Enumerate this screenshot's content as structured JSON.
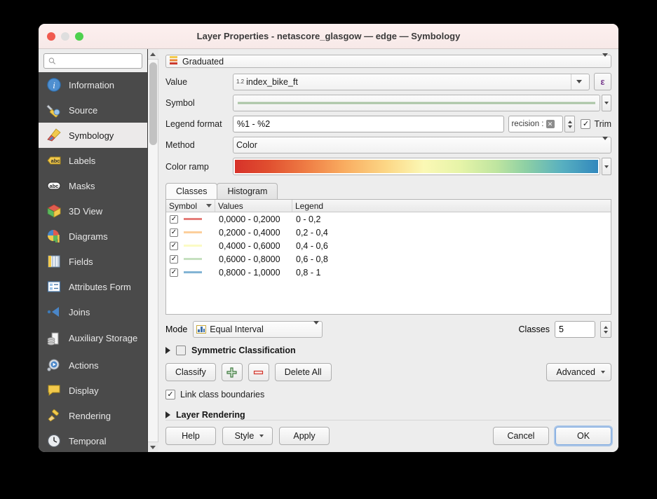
{
  "window": {
    "title": "Layer Properties - netascore_glasgow — edge — Symbology"
  },
  "sidebar": {
    "search_placeholder": "",
    "search_value": "",
    "items": [
      {
        "label": "Information",
        "icon": "information-icon"
      },
      {
        "label": "Source",
        "icon": "source-icon"
      },
      {
        "label": "Symbology",
        "icon": "symbology-icon",
        "active": true
      },
      {
        "label": "Labels",
        "icon": "labels-icon"
      },
      {
        "label": "Masks",
        "icon": "masks-icon"
      },
      {
        "label": "3D View",
        "icon": "3d-view-icon"
      },
      {
        "label": "Diagrams",
        "icon": "diagrams-icon"
      },
      {
        "label": "Fields",
        "icon": "fields-icon"
      },
      {
        "label": "Attributes Form",
        "icon": "attributes-form-icon"
      },
      {
        "label": "Joins",
        "icon": "joins-icon"
      },
      {
        "label": "Auxiliary Storage",
        "icon": "auxiliary-storage-icon"
      },
      {
        "label": "Actions",
        "icon": "actions-icon"
      },
      {
        "label": "Display",
        "icon": "display-icon"
      },
      {
        "label": "Rendering",
        "icon": "rendering-icon"
      },
      {
        "label": "Temporal",
        "icon": "temporal-icon"
      }
    ]
  },
  "symbology": {
    "renderer": "Graduated",
    "value_label": "Value",
    "value": "index_bike_ft",
    "value_type_badge": "1.2",
    "expression_button": "ε",
    "symbol_label": "Symbol",
    "symbol_line_color": "#a9c4a4",
    "legend_format_label": "Legend format",
    "legend_format": "%1 - %2",
    "precision_text": "recision :",
    "trim_label": "Trim",
    "trim_checked": "✓",
    "method_label": "Method",
    "method": "Color",
    "color_ramp_label": "Color ramp",
    "color_ramp_name": "Spectral"
  },
  "tabs": [
    {
      "label": "Classes",
      "active": true
    },
    {
      "label": "Histogram",
      "active": false
    }
  ],
  "table": {
    "headers": {
      "symbol": "Symbol",
      "values": "Values",
      "legend": "Legend"
    },
    "rows": [
      {
        "checked": "✓",
        "color": "#e57d79",
        "values": "0,0000 - 0,2000",
        "legend": "0 - 0,2"
      },
      {
        "checked": "✓",
        "color": "#fccf9c",
        "values": "0,2000 - 0,4000",
        "legend": "0,2 - 0,4"
      },
      {
        "checked": "✓",
        "color": "#fbfbc4",
        "values": "0,4000 - 0,6000",
        "legend": "0,4 - 0,6"
      },
      {
        "checked": "✓",
        "color": "#c6e0c0",
        "values": "0,6000 - 0,8000",
        "legend": "0,6 - 0,8"
      },
      {
        "checked": "✓",
        "color": "#83b4d4",
        "values": "0,8000 - 1,0000",
        "legend": "0,8 - 1"
      }
    ]
  },
  "controls": {
    "mode_label": "Mode",
    "mode": "Equal Interval",
    "classes_label": "Classes",
    "classes": "5",
    "symmetric_classification": "Symmetric Classification",
    "symmetric_checked": false,
    "classify": "Classify",
    "add_class": "＋",
    "delete_class": "−",
    "delete_all": "Delete All",
    "advanced": "Advanced",
    "link_class_boundaries": "Link class boundaries",
    "link_checked": "✓",
    "layer_rendering": "Layer Rendering"
  },
  "footer": {
    "help": "Help",
    "style": "Style",
    "apply": "Apply",
    "cancel": "Cancel",
    "ok": "OK"
  }
}
